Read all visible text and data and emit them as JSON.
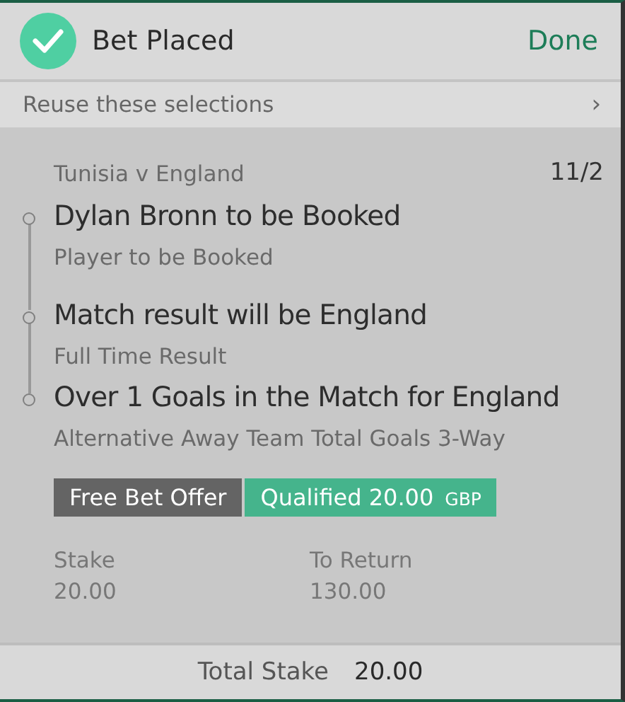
{
  "header": {
    "title": "Bet Placed",
    "done": "Done"
  },
  "reuse": {
    "label": "Reuse these selections",
    "chevron": "›"
  },
  "bet": {
    "event": "Tunisia v England",
    "odds": "11/2",
    "legs": [
      {
        "selection": "Dylan Bronn to be Booked",
        "market": "Player to be Booked"
      },
      {
        "selection": "Match result will be England",
        "market": "Full Time Result"
      },
      {
        "selection": "Over 1 Goals in the Match for England",
        "market": "Alternative Away Team Total Goals 3-Way"
      }
    ],
    "offer": {
      "label": "Free Bet Offer",
      "status": "Qualified 20.00",
      "currency": "GBP"
    },
    "stake_label": "Stake",
    "stake": "20.00",
    "return_label": "To Return",
    "return": "130.00"
  },
  "footer": {
    "label": "Total Stake",
    "value": "20.00"
  }
}
